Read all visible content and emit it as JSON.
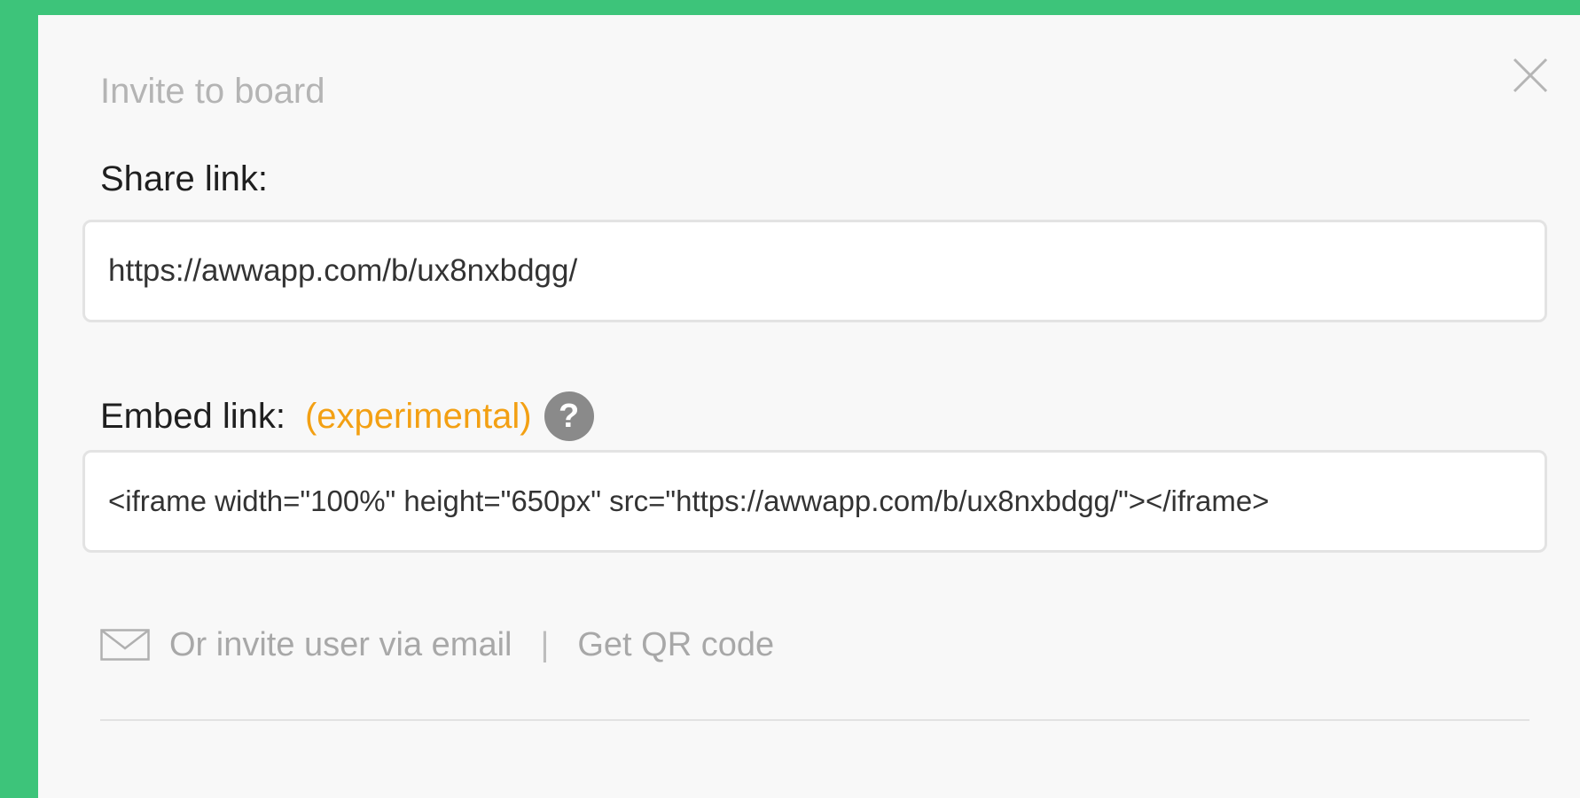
{
  "dialog": {
    "title": "Invite to board",
    "close_icon": "close-icon"
  },
  "share": {
    "label": "Share link:",
    "value": "https://awwapp.com/b/ux8nxbdgg/"
  },
  "embed": {
    "label": "Embed link:",
    "tag": "(experimental)",
    "help_glyph": "?",
    "value": "<iframe width=\"100%\" height=\"650px\" src=\"https://awwapp.com/b/ux8nxbdgg/\"></iframe>"
  },
  "actions": {
    "email_label": "Or invite user via email",
    "separator": "|",
    "qr_label": "Get QR code"
  },
  "colors": {
    "background": "#3dc47a",
    "dialog": "#f8f8f8",
    "accent": "#f3a013",
    "muted": "#a8a8a8"
  }
}
